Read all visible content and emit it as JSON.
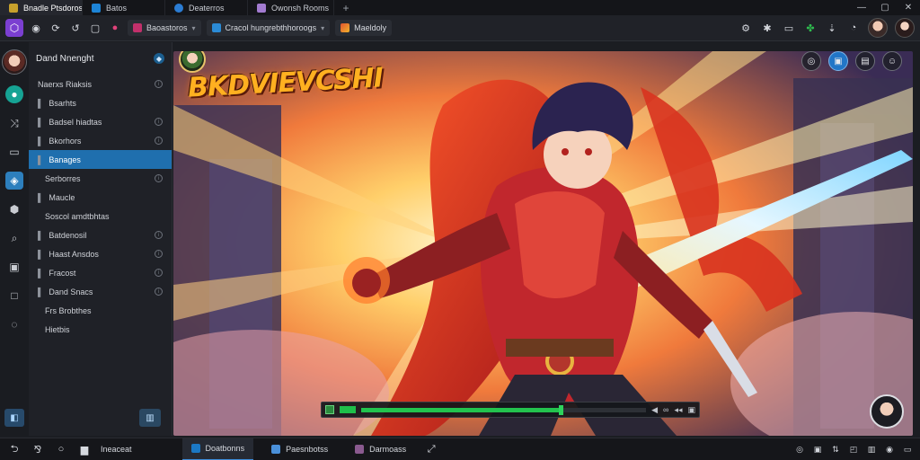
{
  "tabs": [
    {
      "label": "Bnadle Ptsdoros",
      "color": "#c7a12c"
    },
    {
      "label": "Batos",
      "color": "#1d84d6"
    },
    {
      "label": "Deaterros",
      "color": "#2b7cd3"
    },
    {
      "label": "Owonsh Rooms",
      "color": "#a27bd0"
    }
  ],
  "toolbar": {
    "left_buttons": [
      "◉",
      "⟳",
      "↺",
      "▢",
      "●"
    ],
    "pill_1": "Baoastoros",
    "pill_2": "Cracol hungrebthhoroogs",
    "pill_3": "Maeldoly"
  },
  "sidebar": {
    "user": "Dand Nnenght",
    "items": [
      {
        "label": "Naerxs Riaksis",
        "bullet": "",
        "info": true,
        "sub": false,
        "active": false
      },
      {
        "label": "Bsarhts",
        "bullet": "▌",
        "info": false,
        "sub": false,
        "active": false
      },
      {
        "label": "Badsel hiadtas",
        "bullet": "▌",
        "info": true,
        "sub": false,
        "active": false
      },
      {
        "label": "Bkorhors",
        "bullet": "▌",
        "info": true,
        "sub": false,
        "active": false
      },
      {
        "label": "Banages",
        "bullet": "▌",
        "info": false,
        "sub": false,
        "active": true
      },
      {
        "label": "Serborres",
        "bullet": "",
        "info": true,
        "sub": true,
        "active": false
      },
      {
        "label": "Maucle",
        "bullet": "▌",
        "info": false,
        "sub": false,
        "active": false
      },
      {
        "label": "Soscol amdtbhtas",
        "bullet": "",
        "info": false,
        "sub": true,
        "active": false
      },
      {
        "label": "Batdenosil",
        "bullet": "▌",
        "info": true,
        "sub": false,
        "active": false
      },
      {
        "label": "Haast Ansdos",
        "bullet": "▌",
        "info": true,
        "sub": false,
        "active": false
      },
      {
        "label": "Fracost",
        "bullet": "▌",
        "info": true,
        "sub": false,
        "active": false
      },
      {
        "label": "Dand Snacs",
        "bullet": "▌",
        "info": true,
        "sub": false,
        "active": false
      },
      {
        "label": "Frs Brobthes",
        "bullet": "",
        "info": false,
        "sub": true,
        "active": false
      },
      {
        "label": "Hietbis",
        "bullet": "",
        "info": false,
        "sub": true,
        "active": false
      }
    ]
  },
  "viewer": {
    "title": "BKDVIEVCSHI",
    "overlay_buttons": [
      "◎",
      "▣",
      "▤",
      "☺"
    ],
    "progress_fraction": 0.7
  },
  "taskbar": {
    "left_icons": [
      "⮌",
      "⅋",
      "○"
    ],
    "label": "Ineaceat",
    "apps": [
      {
        "label": "Doatbonns",
        "color": "#1b78c4",
        "active": true
      },
      {
        "label": "Paesnbotss",
        "color": "#4a90d9",
        "active": false
      },
      {
        "label": "Darmoass",
        "color": "#8a5a8f",
        "active": false
      }
    ],
    "tray": [
      "◎",
      "▣",
      "⇅",
      "◰",
      "▥",
      "◉",
      "▭"
    ]
  },
  "colors": {
    "accent": "#1f6fae",
    "progress": "#23c34e"
  }
}
